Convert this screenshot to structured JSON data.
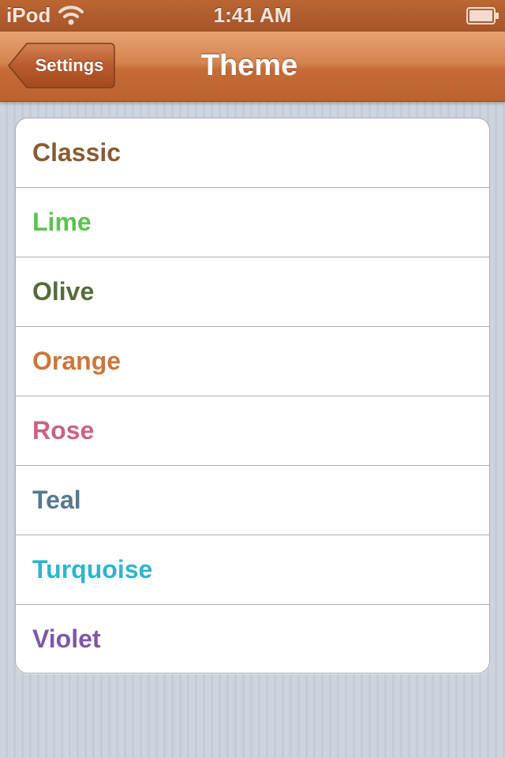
{
  "status_bar": {
    "carrier": "iPod",
    "time": "1:41 AM",
    "wifi_icon": "wifi-icon",
    "battery_icon": "battery-full-icon"
  },
  "nav_bar": {
    "back_label": "Settings",
    "title": "Theme"
  },
  "themes": [
    {
      "label": "Classic",
      "color": "#8b5a32"
    },
    {
      "label": "Lime",
      "color": "#5bc24f"
    },
    {
      "label": "Olive",
      "color": "#556b3a"
    },
    {
      "label": "Orange",
      "color": "#cc7639"
    },
    {
      "label": "Rose",
      "color": "#cf5f83"
    },
    {
      "label": "Teal",
      "color": "#56798d"
    },
    {
      "label": "Turquoise",
      "color": "#2fb4cc"
    },
    {
      "label": "Violet",
      "color": "#7d56a8"
    }
  ],
  "colors": {
    "status_bar_bg": "#a6552a",
    "nav_bar_bg": "#d4844f",
    "background": "#cbd2dc"
  }
}
